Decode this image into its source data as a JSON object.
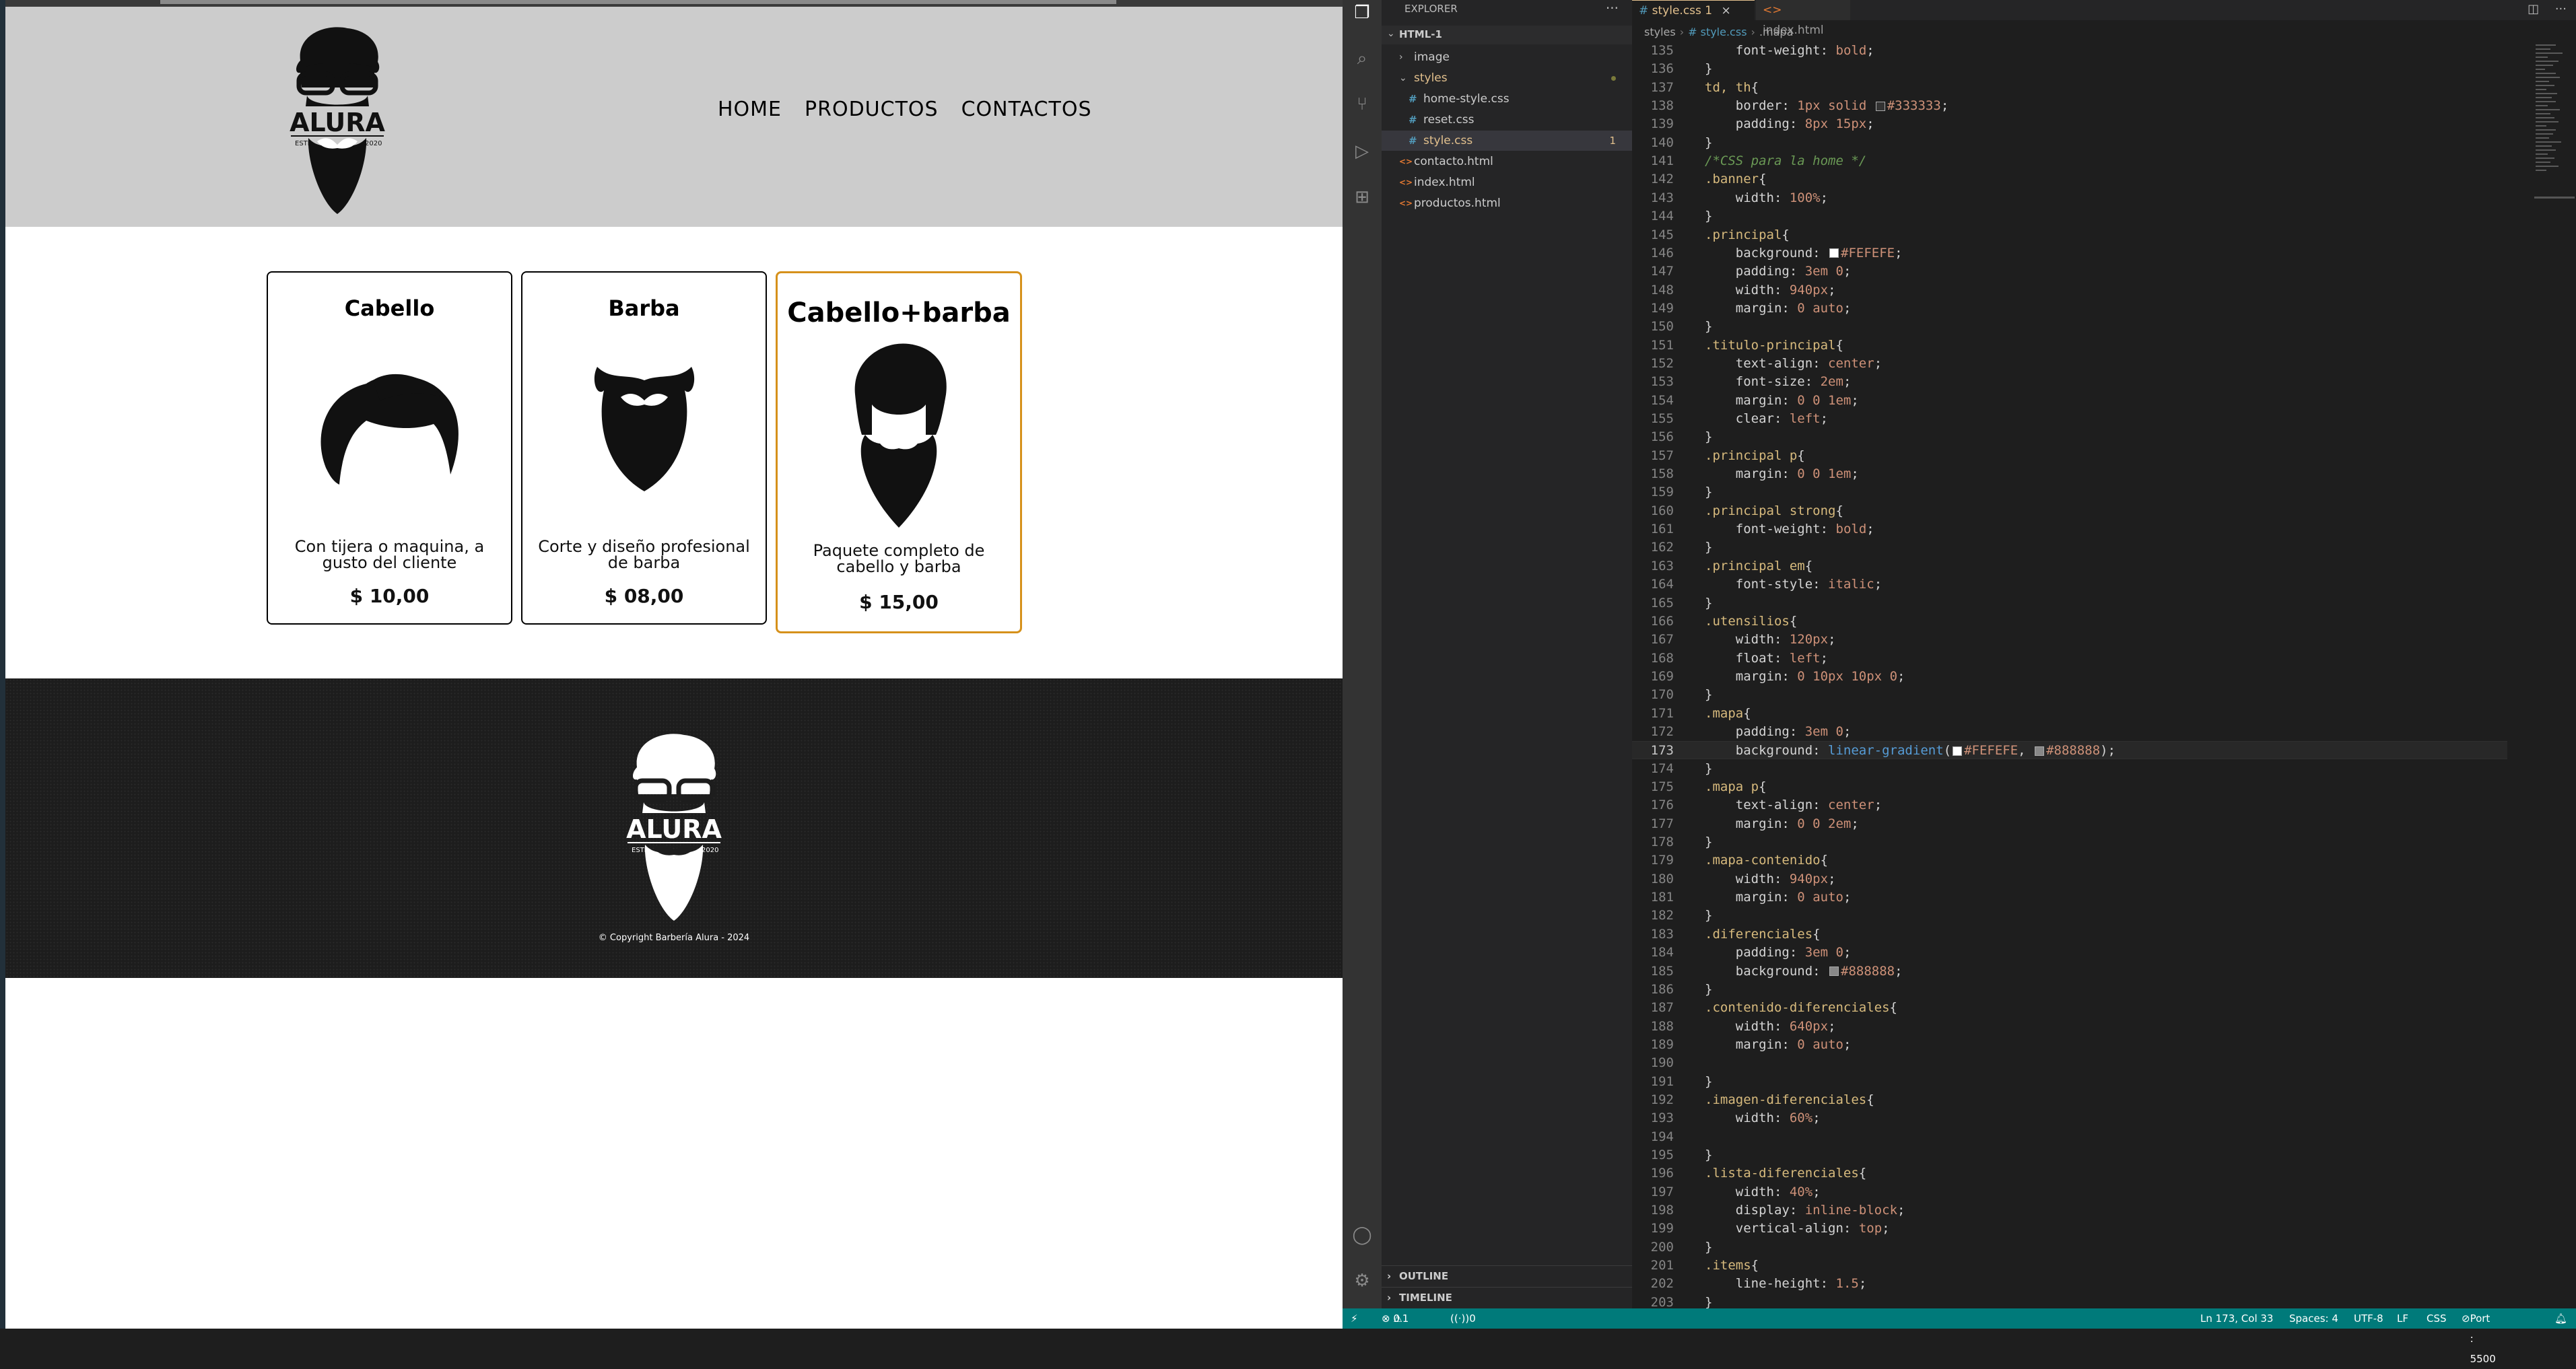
{
  "site": {
    "nav": [
      "HOME",
      "PRODUCTOS",
      "CONTACTOS"
    ],
    "logo_text": "ALURA",
    "logo_estd": "ESTD",
    "logo_year": "2020",
    "cards": [
      {
        "title": "Cabello",
        "desc": "Con tijera o maquina, a gusto del cliente",
        "price": "$ 10,00",
        "image": "hair-icon"
      },
      {
        "title": "Barba",
        "desc": "Corte y diseño profesional de barba",
        "price": "$ 08,00",
        "image": "beard-icon"
      },
      {
        "title": "Cabello+barba",
        "desc": "Paquete completo de cabello y barba",
        "price": "$ 15,00",
        "image": "hair-beard-icon"
      }
    ],
    "copyright": "© Copyright Barbería Alura - 2024"
  },
  "vscode": {
    "explorer_title": "EXPLORER",
    "folder": "HTML-1",
    "tree": [
      {
        "name": "image",
        "type": "folder-collapsed",
        "indent": 1
      },
      {
        "name": "styles",
        "type": "folder-open",
        "indent": 1
      },
      {
        "name": "home-style.css",
        "type": "css",
        "indent": 2
      },
      {
        "name": "reset.css",
        "type": "css",
        "indent": 2
      },
      {
        "name": "style.css",
        "type": "css",
        "indent": 2,
        "badge": "1",
        "selected": true
      },
      {
        "name": "contacto.html",
        "type": "html",
        "indent": 1
      },
      {
        "name": "index.html",
        "type": "html",
        "indent": 1
      },
      {
        "name": "productos.html",
        "type": "html",
        "indent": 1
      }
    ],
    "outline": "OUTLINE",
    "timeline": "TIMELINE",
    "tabs": [
      {
        "label": "style.css 1",
        "active": true
      },
      {
        "label": "index.html",
        "active": false
      }
    ],
    "breadcrumb": [
      "styles",
      "# style.css",
      ".mapa"
    ],
    "code_lines": [
      {
        "n": "135",
        "html": "    <span class='t-prop'>font-weight</span>: <span class='t-val'>bold</span>;"
      },
      {
        "n": "136",
        "html": "}"
      },
      {
        "n": "137",
        "html": "<span class='t-sel'>td, th</span>{"
      },
      {
        "n": "138",
        "html": "    <span class='t-prop'>border</span>: <span class='t-num'>1px</span> <span class='t-val'>solid</span> <span class='sw' style='background:#333333'></span><span class='t-val'>#333333</span>;"
      },
      {
        "n": "139",
        "html": "    <span class='t-prop'>padding</span>: <span class='t-num'>8px 15px</span>;"
      },
      {
        "n": "140",
        "html": "}"
      },
      {
        "n": "141",
        "html": "<span class='t-com'>/*CSS para la home */</span>"
      },
      {
        "n": "142",
        "html": "<span class='t-sel'>.banner</span>{"
      },
      {
        "n": "143",
        "html": "    <span class='t-prop'>width</span>: <span class='t-num'>100%</span>;"
      },
      {
        "n": "144",
        "html": "}"
      },
      {
        "n": "145",
        "html": "<span class='t-sel'>.principal</span>{"
      },
      {
        "n": "146",
        "html": "    <span class='t-prop'>background</span>: <span class='sw' style='background:#FEFEFE'></span><span class='t-val'>#FEFEFE</span>;"
      },
      {
        "n": "147",
        "html": "    <span class='t-prop'>padding</span>: <span class='t-num'>3em 0</span>;"
      },
      {
        "n": "148",
        "html": "    <span class='t-prop'>width</span>: <span class='t-num'>940px</span>;"
      },
      {
        "n": "149",
        "html": "    <span class='t-prop'>margin</span>: <span class='t-num'>0</span> <span class='t-val'>auto</span>;"
      },
      {
        "n": "150",
        "html": "}"
      },
      {
        "n": "151",
        "html": "<span class='t-sel'>.titulo-principal</span>{"
      },
      {
        "n": "152",
        "html": "    <span class='t-prop'>text-align</span>: <span class='t-val'>center</span>;"
      },
      {
        "n": "153",
        "html": "    <span class='t-prop'>font-size</span>: <span class='t-num'>2em</span>;"
      },
      {
        "n": "154",
        "html": "    <span class='t-prop'>margin</span>: <span class='t-num'>0 0 1em</span>;"
      },
      {
        "n": "155",
        "html": "    <span class='t-prop'>clear</span>: <span class='t-val'>left</span>;"
      },
      {
        "n": "156",
        "html": "}"
      },
      {
        "n": "157",
        "html": "<span class='t-sel'>.principal p</span>{"
      },
      {
        "n": "158",
        "html": "    <span class='t-prop'>margin</span>: <span class='t-num'>0 0 1em</span>;"
      },
      {
        "n": "159",
        "html": "}"
      },
      {
        "n": "160",
        "html": "<span class='t-sel'>.principal strong</span>{"
      },
      {
        "n": "161",
        "html": "    <span class='t-prop'>font-weight</span>: <span class='t-val'>bold</span>;"
      },
      {
        "n": "162",
        "html": "}"
      },
      {
        "n": "163",
        "html": "<span class='t-sel'>.principal em</span>{"
      },
      {
        "n": "164",
        "html": "    <span class='t-prop'>font-style</span>: <span class='t-val'>italic</span>;"
      },
      {
        "n": "165",
        "html": "}"
      },
      {
        "n": "166",
        "html": "<span class='t-sel'>.utensilios</span>{"
      },
      {
        "n": "167",
        "html": "    <span class='t-prop'>width</span>: <span class='t-num'>120px</span>;"
      },
      {
        "n": "168",
        "html": "    <span class='t-prop'>float</span>: <span class='t-val'>left</span>;"
      },
      {
        "n": "169",
        "html": "    <span class='t-prop'>margin</span>: <span class='t-num'>0 10px 10px 0</span>;"
      },
      {
        "n": "170",
        "html": "}"
      },
      {
        "n": "171",
        "html": "<span class='t-sel'>.mapa</span>{"
      },
      {
        "n": "172",
        "html": "    <span class='t-prop'>padding</span>: <span class='t-num'>3em 0</span>;"
      },
      {
        "n": "173",
        "html": "    <span class='t-prop'>background</span>: <span class='t-fn'>linear-gradient</span>(<span class='sw' style='background:#FEFEFE'></span><span class='t-val'>#FEFEFE</span>, <span class='sw' style='background:#888888'></span><span class='t-val'>#888888</span>);",
        "current": true
      },
      {
        "n": "174",
        "html": "}"
      },
      {
        "n": "175",
        "html": "<span class='t-sel'>.mapa p</span>{"
      },
      {
        "n": "176",
        "html": "    <span class='t-prop'>text-align</span>: <span class='t-val'>center</span>;"
      },
      {
        "n": "177",
        "html": "    <span class='t-prop'>margin</span>: <span class='t-num'>0 0 2em</span>;"
      },
      {
        "n": "178",
        "html": "}"
      },
      {
        "n": "179",
        "html": "<span class='t-sel'>.mapa-contenido</span>{"
      },
      {
        "n": "180",
        "html": "    <span class='t-prop'>width</span>: <span class='t-num'>940px</span>;"
      },
      {
        "n": "181",
        "html": "    <span class='t-prop'>margin</span>: <span class='t-num'>0</span> <span class='t-val'>auto</span>;"
      },
      {
        "n": "182",
        "html": "}"
      },
      {
        "n": "183",
        "html": "<span class='t-sel'>.diferenciales</span>{"
      },
      {
        "n": "184",
        "html": "    <span class='t-prop'>padding</span>: <span class='t-num'>3em 0</span>;"
      },
      {
        "n": "185",
        "html": "    <span class='t-prop'>background</span>: <span class='sw' style='background:#888888'></span><span class='t-val'>#888888</span>;"
      },
      {
        "n": "186",
        "html": "}"
      },
      {
        "n": "187",
        "html": "<span class='t-sel'>.contenido-diferenciales</span>{"
      },
      {
        "n": "188",
        "html": "    <span class='t-prop'>width</span>: <span class='t-num'>640px</span>;"
      },
      {
        "n": "189",
        "html": "    <span class='t-prop'>margin</span>: <span class='t-num'>0</span> <span class='t-val'>auto</span>;"
      },
      {
        "n": "190",
        "html": ""
      },
      {
        "n": "191",
        "html": "}"
      },
      {
        "n": "192",
        "html": "<span class='t-sel'>.imagen-diferenciales</span>{"
      },
      {
        "n": "193",
        "html": "    <span class='t-prop'>width</span>: <span class='t-num'>60%</span>;"
      },
      {
        "n": "194",
        "html": ""
      },
      {
        "n": "195",
        "html": "}"
      },
      {
        "n": "196",
        "html": "<span class='t-sel'>.lista-diferenciales</span>{"
      },
      {
        "n": "197",
        "html": "    <span class='t-prop'>width</span>: <span class='t-num'>40%</span>;"
      },
      {
        "n": "198",
        "html": "    <span class='t-prop'>display</span>: <span class='t-val'>inline-block</span>;"
      },
      {
        "n": "199",
        "html": "    <span class='t-prop'>vertical-align</span>: <span class='t-val'>top</span>;"
      },
      {
        "n": "200",
        "html": "}"
      },
      {
        "n": "201",
        "html": "<span class='t-sel'>.items</span>{"
      },
      {
        "n": "202",
        "html": "    <span class='t-prop'>line-height</span>: <span class='t-num'>1.5</span>;"
      },
      {
        "n": "203",
        "html": "}"
      }
    ],
    "status": {
      "errors": "0",
      "warnings": "1",
      "ports": "0",
      "position": "Ln 173, Col 33",
      "spaces": "Spaces: 4",
      "encoding": "UTF-8",
      "eol": "LF",
      "language": "CSS",
      "port": "Port : 5500"
    },
    "colors": {
      "accent": "#d6911b",
      "status_bar": "#007a7a"
    }
  }
}
